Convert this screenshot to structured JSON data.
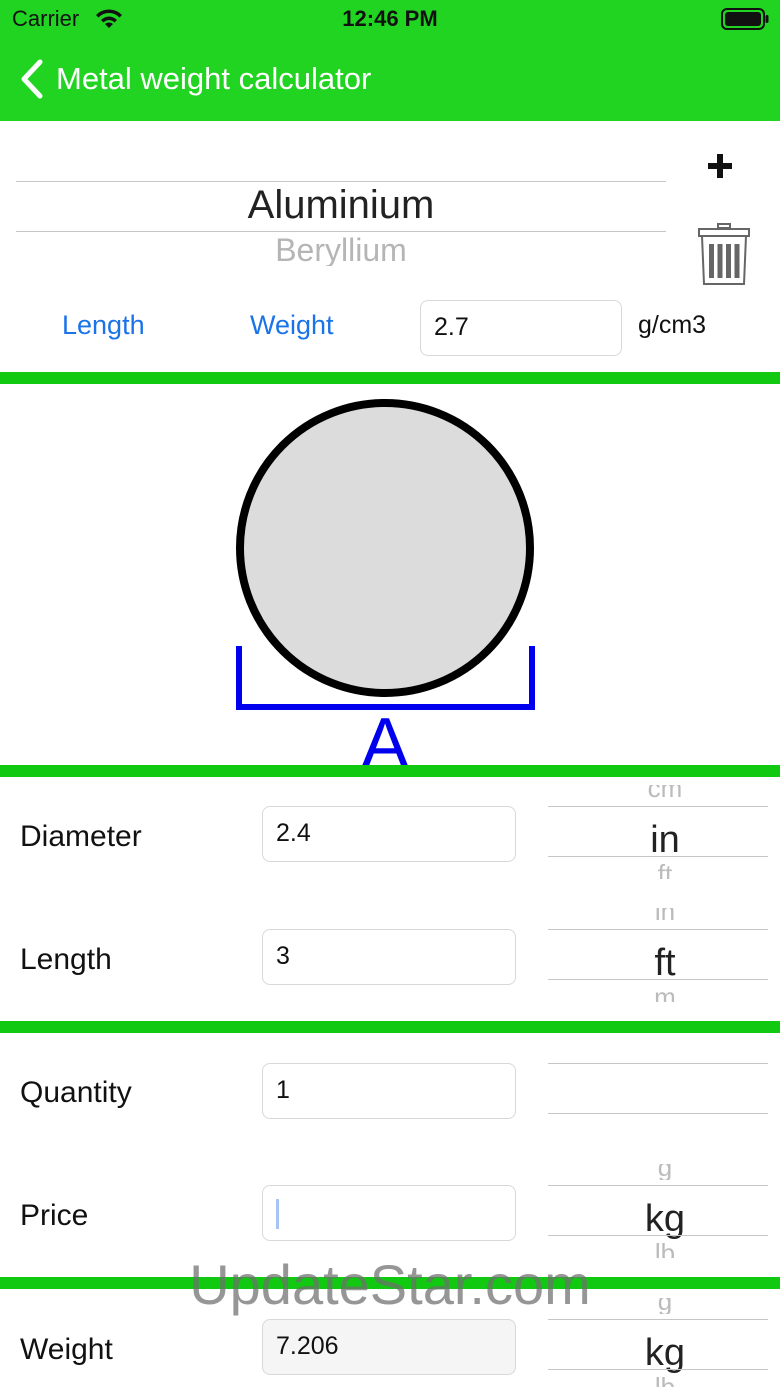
{
  "status_bar": {
    "carrier": "Carrier",
    "time": "12:46 PM"
  },
  "nav": {
    "title": "Metal weight calculator"
  },
  "material_picker": {
    "selected": "Aluminium",
    "next": "Beryllium"
  },
  "toolbar": {
    "length_label": "Length",
    "weight_label": "Weight"
  },
  "density": {
    "value": "2.7",
    "unit": "g/cm3"
  },
  "shape": {
    "dimension_label": "A"
  },
  "rows": {
    "diameter": {
      "label": "Diameter",
      "value": "2.4",
      "unit_prev": "cm",
      "unit": "in",
      "unit_next": "ft"
    },
    "length": {
      "label": "Length",
      "value": "3",
      "unit_prev": "in",
      "unit": "ft",
      "unit_next": "m"
    },
    "quantity": {
      "label": "Quantity",
      "value": "1"
    },
    "price": {
      "label": "Price",
      "value": "",
      "unit_prev": "g",
      "unit": "kg",
      "unit_next": "lb"
    },
    "weight": {
      "label": "Weight",
      "value": "7.206",
      "unit_prev": "g",
      "unit": "kg",
      "unit_next": "lb"
    }
  },
  "watermark": "UpdateStar.com",
  "colors": {
    "nav_green": "#22d422",
    "divider_green": "#11c911",
    "link_blue": "#1a73e8",
    "dimension_blue": "#0000ee"
  }
}
